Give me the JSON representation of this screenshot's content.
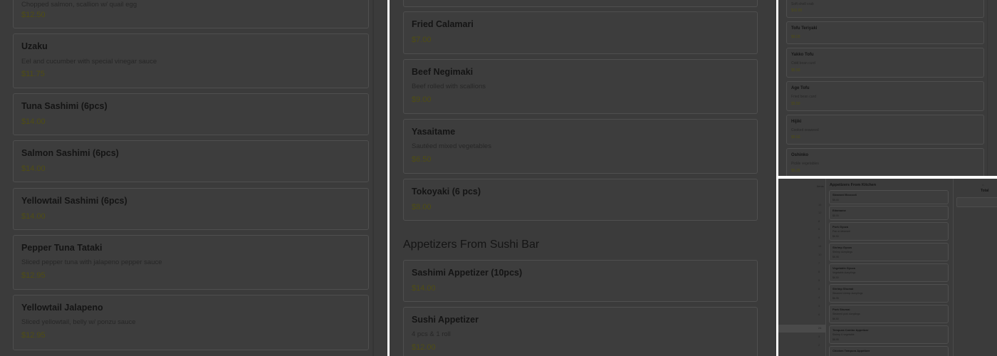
{
  "panel1": {
    "items": [
      {
        "name": "",
        "desc": "Chopped salmon, scallion w/ quail egg",
        "price": "$12.50"
      },
      {
        "name": "Uzaku",
        "desc": "Eel and cucumber with special vinegar sauce",
        "price": "$11.75"
      },
      {
        "name": "Tuna Sashimi (6pcs)",
        "desc": "",
        "price": "$14.00"
      },
      {
        "name": "Salmon Sashimi (6pcs)",
        "desc": "",
        "price": "$14.00"
      },
      {
        "name": "Yellowtail Sashimi (6pcs)",
        "desc": "",
        "price": "$14.00"
      },
      {
        "name": "Pepper Tuna Tataki",
        "desc": "Sliced pepper tuna with jalapeno pepper sauce",
        "price": "$12.95"
      },
      {
        "name": "Yellowtail Jalapeno",
        "desc": "Sliced yellowtail, belly w/ ponzu sauce",
        "price": "$12.95"
      }
    ]
  },
  "panel2": {
    "items": [
      {
        "name": "Fried Calamari",
        "desc": "",
        "price": "$7.00"
      },
      {
        "name": "Beef Negimaki",
        "desc": "Beef rolled with scallions",
        "price": "$9.00"
      },
      {
        "name": "Yasaitame",
        "desc": "Sautéed mixed vegetables",
        "price": "$6.50"
      },
      {
        "name": "Tokoyaki (6 pcs)",
        "desc": "",
        "price": "$8.00"
      }
    ],
    "section_title": "Appetizers From Sushi Bar",
    "section_items": [
      {
        "name": "Sashimi Appetizer (10pcs)",
        "desc": "",
        "price": "$14.00"
      },
      {
        "name": "Sushi Appetizer",
        "desc": "4 pcs & 1 roll",
        "price": "$12.00"
      }
    ]
  },
  "panel3": {
    "items": [
      {
        "name": "",
        "desc": "Soft shell crab",
        "price": "$10.00"
      },
      {
        "name": "Tofu Teriyaki",
        "desc": "",
        "price": "$9.00"
      },
      {
        "name": "Yakko Tofu",
        "desc": "Cold bean curd",
        "price": "$5.50"
      },
      {
        "name": "Age Tofu",
        "desc": "Fried bean curd",
        "price": "$5.50"
      },
      {
        "name": "Hijiki",
        "desc": "Cooked seaweed",
        "price": "$5.50"
      },
      {
        "name": "Oshinko",
        "desc": "Pickle vegetables",
        "price": "$5.25"
      }
    ]
  },
  "panel4": {
    "sidebar_header": "Items",
    "categories": [
      {
        "count": "15"
      },
      {
        "count": "12"
      },
      {
        "count": "8"
      },
      {
        "count": "6"
      },
      {
        "count": "9"
      },
      {
        "count": "14"
      },
      {
        "count": "10"
      },
      {
        "count": "7"
      },
      {
        "count": "8"
      },
      {
        "count": "5"
      },
      {
        "count": "6"
      },
      {
        "count": "4"
      },
      {
        "count": "3"
      },
      {
        "count": "6"
      },
      {
        "count": "24"
      },
      {
        "count": "3"
      },
      {
        "count": "2"
      }
    ],
    "section_title": "Appetizers From Kitchen",
    "items": [
      {
        "name": "Steamed Broccoli",
        "desc": "",
        "price": "$5.00"
      },
      {
        "name": "Edamame",
        "desc": "",
        "price": "$5.00"
      },
      {
        "name": "Pork Gyoza",
        "desc": "Pan or steamed",
        "price": "$6.50"
      },
      {
        "name": "Shrimp Gyoza",
        "desc": "Shrimp dumplings",
        "price": "$6.95"
      },
      {
        "name": "Vegetable Gyoza",
        "desc": "Vegetable dumplings",
        "price": "$6.50"
      },
      {
        "name": "Shrimp Shumai",
        "desc": "Steamed shrimp dumplings",
        "price": "$6.95"
      },
      {
        "name": "Pork Shumai",
        "desc": "Steamed pork dumplings",
        "price": "$6.50"
      },
      {
        "name": "Tempura Combo Appetizer",
        "desc": "Shrimp & vegetable",
        "price": "$8.95"
      },
      {
        "name": "Chicken Tempura Appetizer",
        "desc": "",
        "price": ""
      }
    ],
    "cart": {
      "title": "Total"
    }
  }
}
